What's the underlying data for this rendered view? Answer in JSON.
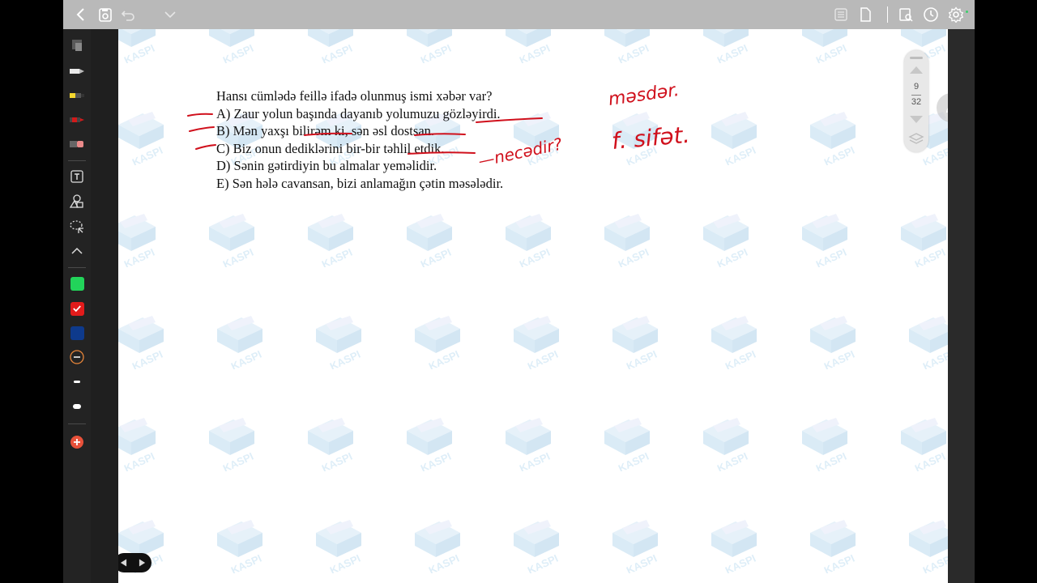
{
  "question": {
    "stem": "Hansı cümlədə feillə ifadə olunmuş ismi xəbər var?",
    "options": [
      "A) Zaur yolun başında dayanıb yolumuzu gözləyirdi.",
      "B) Mən yaxşı bilirəm ki, sən əsl dostsan.",
      "C) Biz onun dediklərini bir-bir təhlil etdik.",
      "D) Sənin gətirdiyin bu almalar yeməlidir.",
      "E) Sən hələ cavansan, bizi anlamağın çətin məsələdir."
    ]
  },
  "annotations": {
    "note_1": "məsdər.",
    "note_2": "f. sifət.",
    "note_3": "—necədir?"
  },
  "watermark": {
    "brand": "KASPI"
  },
  "page_indicator": {
    "current": "9",
    "total": "32"
  },
  "colors": {
    "ink": "#d0101c",
    "swatch_green": "#22d45a",
    "swatch_red": "#e21b1b",
    "swatch_navy": "#0e3a8c",
    "add_button": "#e8513a"
  },
  "icons": {
    "top": [
      "back-icon",
      "save-icon",
      "undo-icon",
      "chevron-down-icon",
      "list-icon",
      "page-icon",
      "search-doc-icon",
      "clock-icon",
      "gear-icon"
    ],
    "left": [
      "eraser-icon",
      "pen-icon",
      "highlighter-icon",
      "red-pen-icon",
      "pink-eraser-icon",
      "text-icon",
      "shapes-icon",
      "lasso-icon",
      "collapse-icon",
      "minus-circle-icon",
      "thin-line-icon",
      "thick-line-icon",
      "add-icon"
    ]
  }
}
